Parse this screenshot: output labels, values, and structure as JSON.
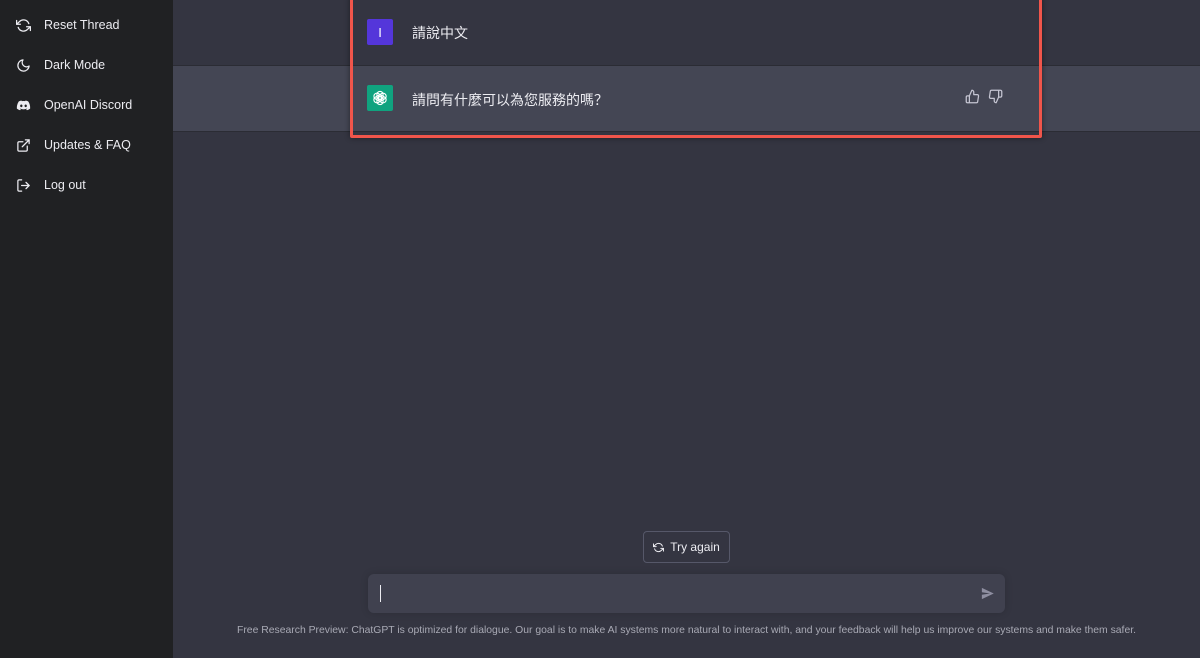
{
  "sidebar": {
    "items": [
      {
        "label": "Reset Thread",
        "icon": "refresh-icon"
      },
      {
        "label": "Dark Mode",
        "icon": "moon-icon"
      },
      {
        "label": "OpenAI Discord",
        "icon": "discord-icon"
      },
      {
        "label": "Updates & FAQ",
        "icon": "external-link-icon"
      },
      {
        "label": "Log out",
        "icon": "logout-icon"
      }
    ]
  },
  "conversation": {
    "user_avatar_letter": "I",
    "user_message": "請說中文",
    "assistant_message": "請問有什麼可以為您服務的嗎？"
  },
  "controls": {
    "try_again_label": "Try again",
    "input_value": ""
  },
  "footer": {
    "text": "Free Research Preview: ChatGPT is optimized for dialogue. Our goal is to make AI systems more natural to interact with, and your feedback will help us improve our systems and make them safer."
  },
  "colors": {
    "sidebar_bg": "#202123",
    "main_bg": "#343541",
    "assistant_row_bg": "#444654",
    "user_avatar": "#5436da",
    "assistant_avatar": "#10a37f",
    "highlight_border": "#f0554b"
  }
}
